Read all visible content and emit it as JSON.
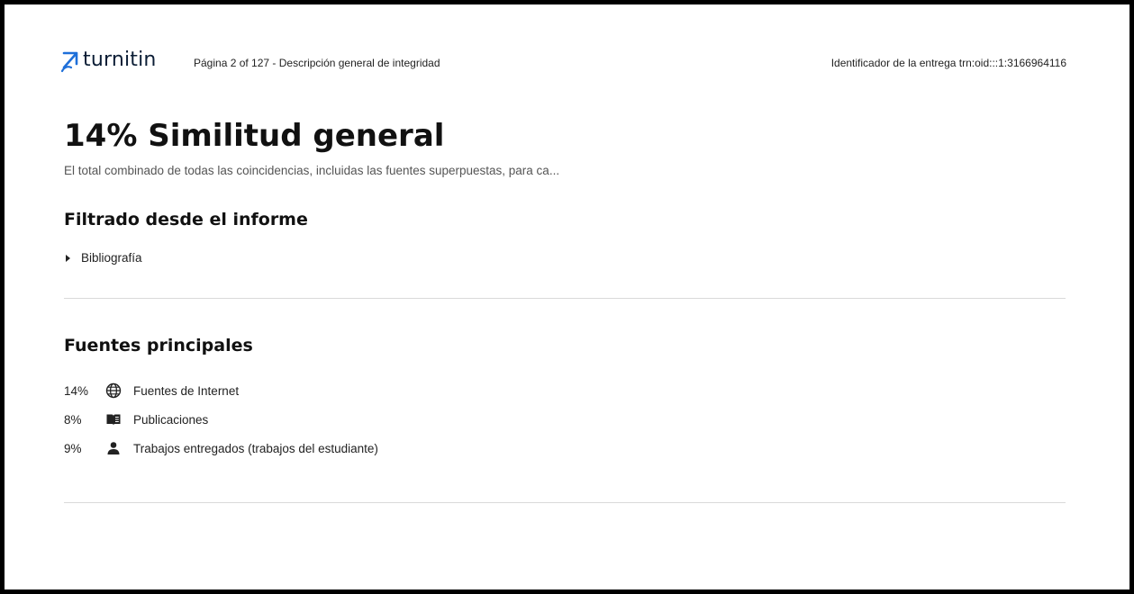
{
  "header": {
    "logo_text": "turnitin",
    "page_info": "Página 2 of 127 - Descripción general de integridad",
    "submission_id": "Identificador de la entrega trn:oid:::1:3166964116",
    "brand_color": "#1e6fd9"
  },
  "overview": {
    "title": "14% Similitud general",
    "subtitle": "El total combinado de todas las coincidencias, incluidas las fuentes superpuestas, para ca..."
  },
  "filtered": {
    "heading": "Filtrado desde el informe",
    "items": [
      {
        "label": "Bibliografía"
      }
    ]
  },
  "sources": {
    "heading": "Fuentes principales",
    "items": [
      {
        "percent": "14%",
        "icon": "globe-icon",
        "label": "Fuentes de Internet"
      },
      {
        "percent": "8%",
        "icon": "book-icon",
        "label": "Publicaciones"
      },
      {
        "percent": "9%",
        "icon": "person-icon",
        "label": "Trabajos entregados (trabajos del estudiante)"
      }
    ]
  }
}
